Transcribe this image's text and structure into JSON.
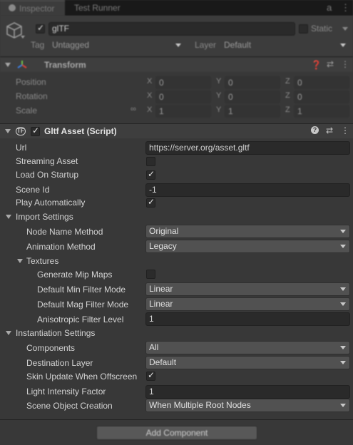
{
  "tabs": {
    "inspector": "Inspector",
    "test_runner": "Test Runner"
  },
  "header": {
    "object_name": "glTF",
    "static_label": "Static",
    "tag_label": "Tag",
    "tag_value": "Untagged",
    "layer_label": "Layer",
    "layer_value": "Default"
  },
  "transform": {
    "title": "Transform",
    "rows": [
      {
        "label": "Position",
        "x": "0",
        "y": "0",
        "z": "0"
      },
      {
        "label": "Rotation",
        "x": "0",
        "y": "0",
        "z": "0"
      },
      {
        "label": "Scale",
        "x": "1",
        "y": "1",
        "z": "1"
      }
    ],
    "axis": {
      "x": "X",
      "y": "Y",
      "z": "Z"
    }
  },
  "gltf": {
    "title": "Gltf Asset (Script)",
    "url_label": "Url",
    "url_value": "https://server.org/asset.gltf",
    "streaming_label": "Streaming Asset",
    "load_on_startup_label": "Load On Startup",
    "scene_id_label": "Scene Id",
    "scene_id_value": "-1",
    "play_auto_label": "Play Automatically",
    "import_settings": {
      "label": "Import Settings",
      "node_name_label": "Node Name Method",
      "node_name_value": "Original",
      "animation_label": "Animation Method",
      "animation_value": "Legacy",
      "textures": {
        "label": "Textures",
        "mipmaps_label": "Generate Mip Maps",
        "min_filter_label": "Default Min Filter Mode",
        "min_filter_value": "Linear",
        "mag_filter_label": "Default Mag Filter Mode",
        "mag_filter_value": "Linear",
        "aniso_label": "Anisotropic Filter Level",
        "aniso_value": "1"
      }
    },
    "instantiation_settings": {
      "label": "Instantiation Settings",
      "components_label": "Components",
      "components_value": "All",
      "dest_layer_label": "Destination Layer",
      "dest_layer_value": "Default",
      "skin_update_label": "Skin Update When Offscreen",
      "light_label": "Light Intensity Factor",
      "light_value": "1",
      "scene_creation_label": "Scene Object Creation",
      "scene_creation_value": "When Multiple Root Nodes"
    }
  },
  "add_component": "Add Component",
  "checkmark": "✓",
  "colors": {
    "panel": "#383838",
    "header": "#3c3c3c",
    "field": "#2a2a2a",
    "dropdown": "#515151",
    "tabbar": "#191919"
  }
}
